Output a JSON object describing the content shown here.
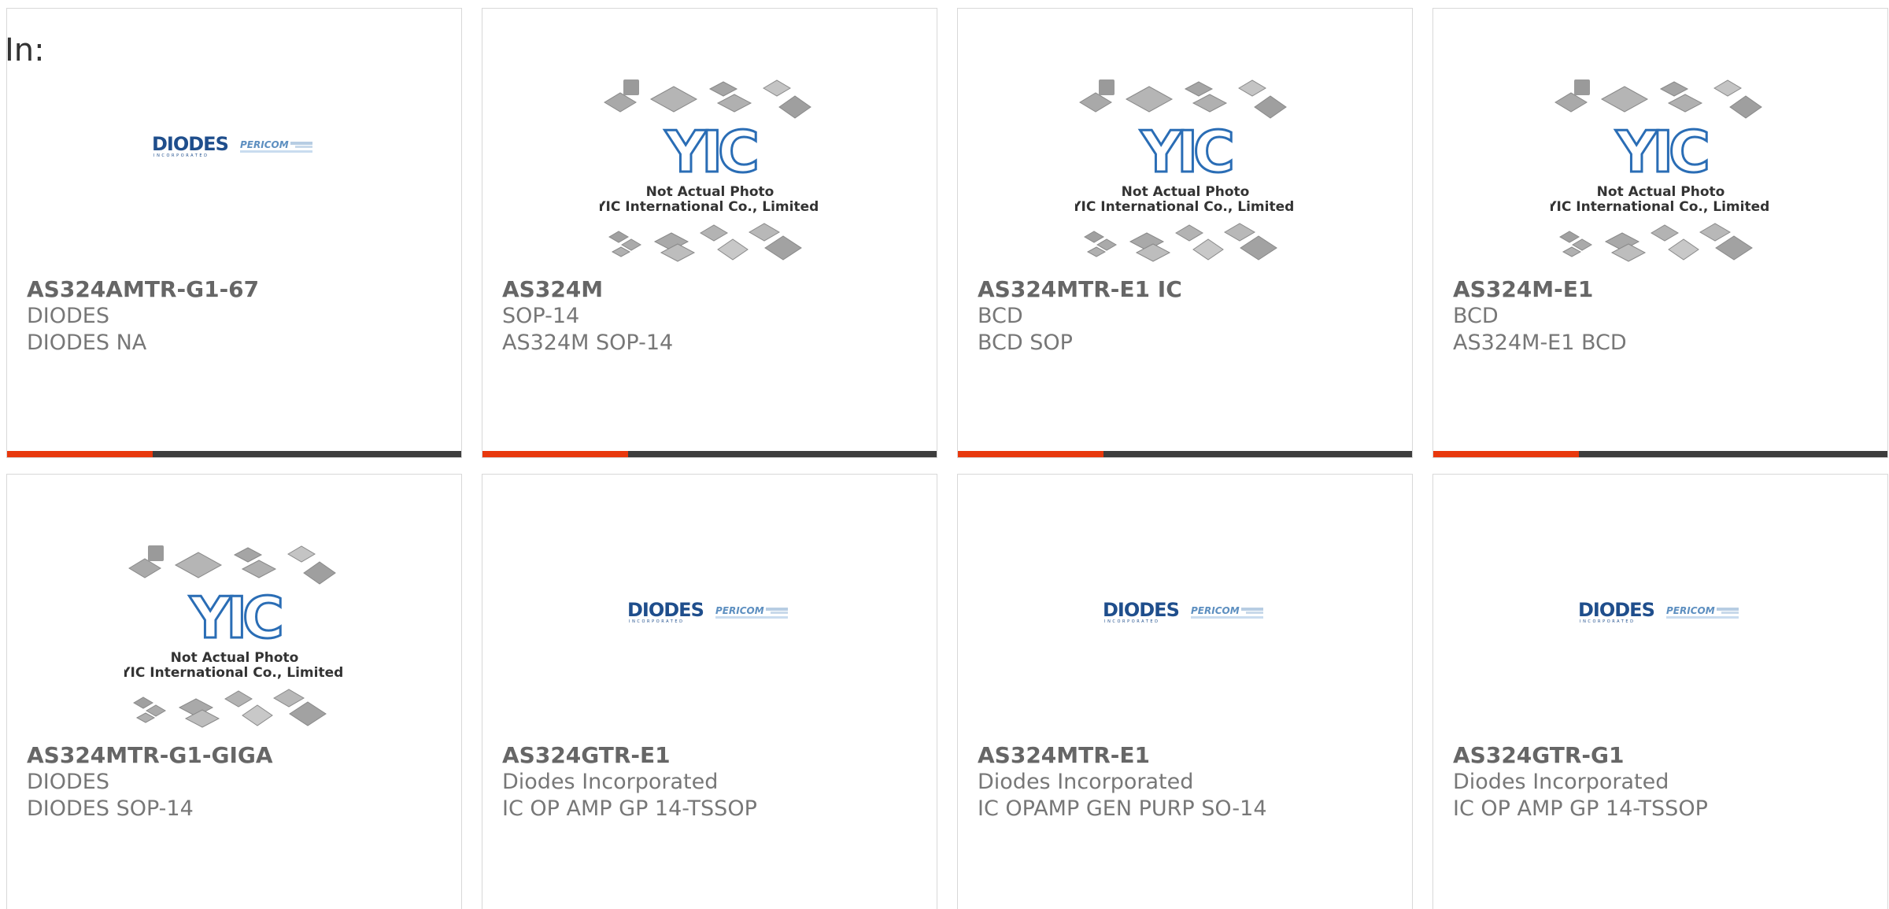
{
  "filter": {
    "label": "In:"
  },
  "theme": {
    "accent": "#e8380d",
    "bar": "#3d3d3d",
    "diodes_blue": "#1f4e8c",
    "yic_blue": "#2a6db5"
  },
  "products": [
    {
      "part": "AS324AMTR-G1-67",
      "manufacturer": "DIODES",
      "description": "DIODES NA",
      "image": "diodes-logo",
      "accent_fraction": 0.32
    },
    {
      "part": "AS324M",
      "manufacturer": "SOP-14",
      "description": "AS324M SOP-14",
      "image": "yic-placeholder",
      "accent_fraction": 0.32
    },
    {
      "part": "AS324MTR-E1 IC",
      "manufacturer": "BCD",
      "description": "BCD SOP",
      "image": "yic-placeholder",
      "accent_fraction": 0.32
    },
    {
      "part": "AS324M-E1",
      "manufacturer": "BCD",
      "description": "AS324M-E1 BCD",
      "image": "yic-placeholder",
      "accent_fraction": 0.32
    },
    {
      "part": "AS324MTR-G1-GIGA",
      "manufacturer": "DIODES",
      "description": "DIODES SOP-14",
      "image": "yic-placeholder"
    },
    {
      "part": "AS324GTR-E1",
      "manufacturer": "Diodes Incorporated",
      "description": "IC OP AMP GP 14-TSSOP",
      "image": "diodes-logo"
    },
    {
      "part": "AS324MTR-E1",
      "manufacturer": "Diodes Incorporated",
      "description": "IC OPAMP GEN PURP SO-14",
      "image": "diodes-logo"
    },
    {
      "part": "AS324GTR-G1",
      "manufacturer": "Diodes Incorporated",
      "description": "IC OP AMP GP 14-TSSOP",
      "image": "diodes-logo"
    }
  ],
  "yic_placeholder": {
    "brand": "YIC",
    "line1": "Not Actual Photo",
    "line2": "YIC International Co., Limited."
  },
  "diodes_logo": {
    "wordmark": "DIODES",
    "tagline": "INCORPORATED",
    "secondary": "PERICOM"
  }
}
